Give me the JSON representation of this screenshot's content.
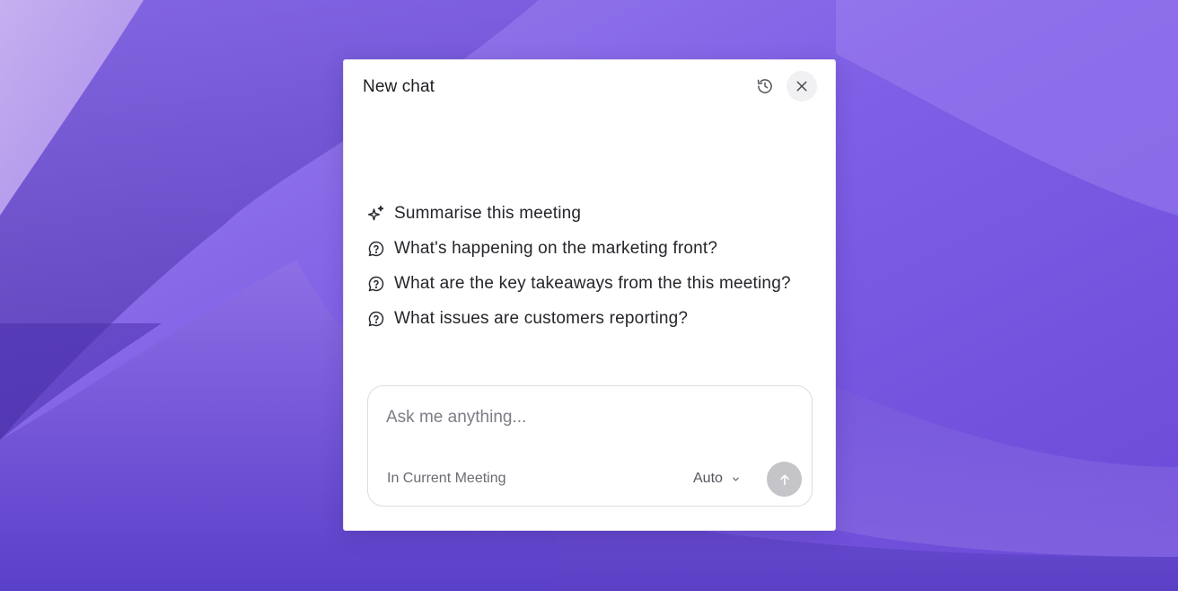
{
  "colors": {
    "wallpaper_base": "#7b5ce0",
    "panel_bg": "#ffffff",
    "send_button_disabled": "#c4c4c9",
    "close_button_bg": "#f1f1f3"
  },
  "chat": {
    "title": "New chat",
    "header_icons": [
      "history-icon",
      "close-icon"
    ],
    "suggestions": [
      {
        "icon": "sparkle-icon",
        "label": "Summarise this meeting"
      },
      {
        "icon": "question-bubble-icon",
        "label": "What's happening on the marketing front?"
      },
      {
        "icon": "question-bubble-icon",
        "label": "What are the key takeaways from the this meeting?"
      },
      {
        "icon": "question-bubble-icon",
        "label": "What issues are customers reporting?"
      }
    ],
    "composer": {
      "placeholder": "Ask me anything...",
      "value": "",
      "context_label": "In Current Meeting",
      "model_label": "Auto",
      "send_icon": "arrow-up-icon"
    }
  }
}
